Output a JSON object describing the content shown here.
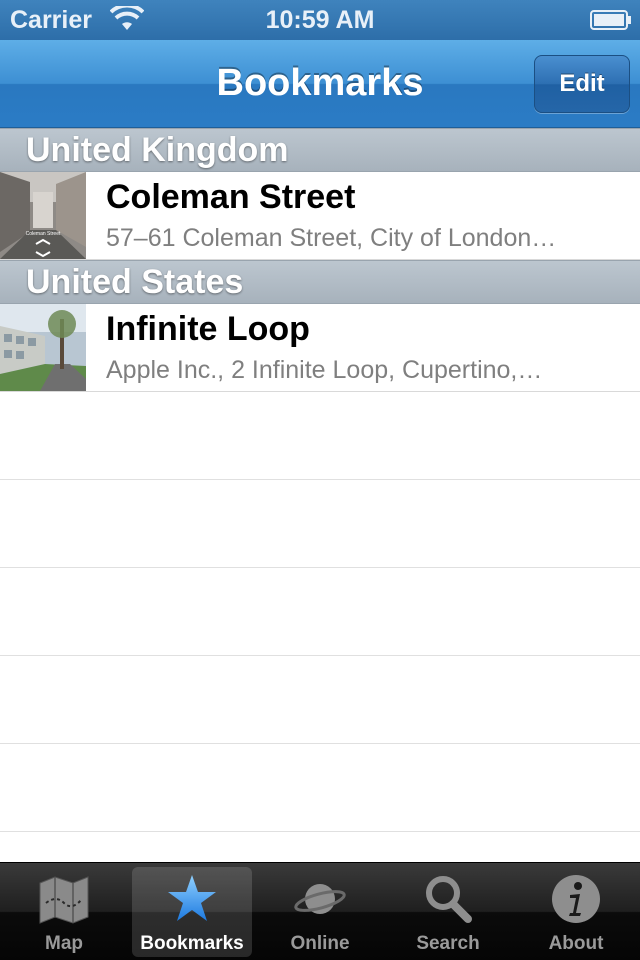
{
  "status_bar": {
    "carrier": "Carrier",
    "time": "10:59 AM"
  },
  "nav": {
    "title": "Bookmarks",
    "edit_label": "Edit"
  },
  "sections": [
    {
      "header": "United Kingdom",
      "rows": [
        {
          "title": "Coleman Street",
          "subtitle": "57–61 Coleman Street, City of London…",
          "thumb_caption": "Coleman Street"
        }
      ]
    },
    {
      "header": "United States",
      "rows": [
        {
          "title": "Infinite Loop",
          "subtitle": "Apple Inc., 2 Infinite Loop, Cupertino,…"
        }
      ]
    }
  ],
  "tabs": [
    {
      "label": "Map",
      "icon": "map-icon",
      "selected": false
    },
    {
      "label": "Bookmarks",
      "icon": "star-icon",
      "selected": true
    },
    {
      "label": "Online",
      "icon": "planet-icon",
      "selected": false
    },
    {
      "label": "Search",
      "icon": "magnifier-icon",
      "selected": false
    },
    {
      "label": "About",
      "icon": "info-icon",
      "selected": false
    }
  ],
  "colors": {
    "nav_blue": "#2b7cc5",
    "tab_selected": "#3e8fe0"
  }
}
